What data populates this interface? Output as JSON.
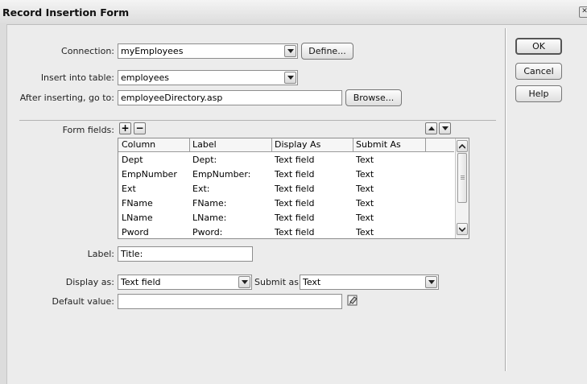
{
  "window": {
    "title": "Record Insertion Form"
  },
  "connection": {
    "label": "Connection:",
    "value": "myEmployees",
    "define_label": "Define..."
  },
  "insert_table": {
    "label": "Insert into table:",
    "value": "employees"
  },
  "after_insert": {
    "label": "After inserting, go to:",
    "value": "employeeDirectory.asp",
    "browse_label": "Browse..."
  },
  "form_fields": {
    "label": "Form fields:",
    "add_glyph": "+",
    "remove_glyph": "−",
    "columns": [
      "Column",
      "Label",
      "Display As",
      "Submit As"
    ],
    "rows": [
      [
        "Dept",
        "Dept:",
        "Text field",
        "Text"
      ],
      [
        "EmpNumber",
        "EmpNumber:",
        "Text field",
        "Text"
      ],
      [
        "Ext",
        "Ext:",
        "Text field",
        "Text"
      ],
      [
        "FName",
        "FName:",
        "Text field",
        "Text"
      ],
      [
        "LName",
        "LName:",
        "Text field",
        "Text"
      ],
      [
        "Pword",
        "Pword:",
        "Text field",
        "Text"
      ]
    ]
  },
  "field_label": {
    "label": "Label:",
    "value": "Title:"
  },
  "display_as": {
    "label": "Display as:",
    "value": "Text field"
  },
  "submit_as": {
    "label": "Submit as:",
    "value": "Text"
  },
  "default_value": {
    "label": "Default value:",
    "value": ""
  },
  "buttons": {
    "ok": "OK",
    "cancel": "Cancel",
    "help": "Help"
  }
}
